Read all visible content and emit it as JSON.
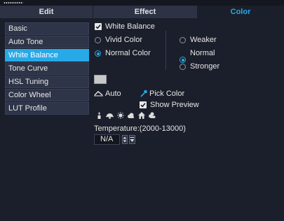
{
  "tabs": {
    "edit": "Edit",
    "effect": "Effect",
    "color": "Color"
  },
  "sidebar": {
    "items": [
      {
        "label": "Basic"
      },
      {
        "label": "Auto Tone"
      },
      {
        "label": "White Balance"
      },
      {
        "label": "Tone Curve"
      },
      {
        "label": "HSL Tuning"
      },
      {
        "label": "Color Wheel"
      },
      {
        "label": "LUT Profile"
      }
    ],
    "active": "White Balance"
  },
  "white_balance": {
    "enable_label": "White Balance",
    "enabled": true,
    "mode_options": [
      "Vivid Color",
      "Normal Color"
    ],
    "mode_selected": "Normal Color",
    "strength_options": [
      "Weaker",
      "Normal",
      "Stronger"
    ],
    "strength_selected": "Normal",
    "auto_label": "Auto",
    "pick_color_label": "Pick Color",
    "show_preview_label": "Show Preview",
    "show_preview_checked": true,
    "temperature_label": "Temperature:(2000-13000)",
    "temperature_value": "N/A",
    "presets": [
      "candle-icon",
      "incandescent-icon",
      "daylight-icon",
      "cloudy-icon",
      "shade-icon",
      "overcast-icon"
    ]
  },
  "colors": {
    "accent": "#27a9e8",
    "background": "#1b1f2b",
    "sidebar_item": "#2e3548"
  }
}
